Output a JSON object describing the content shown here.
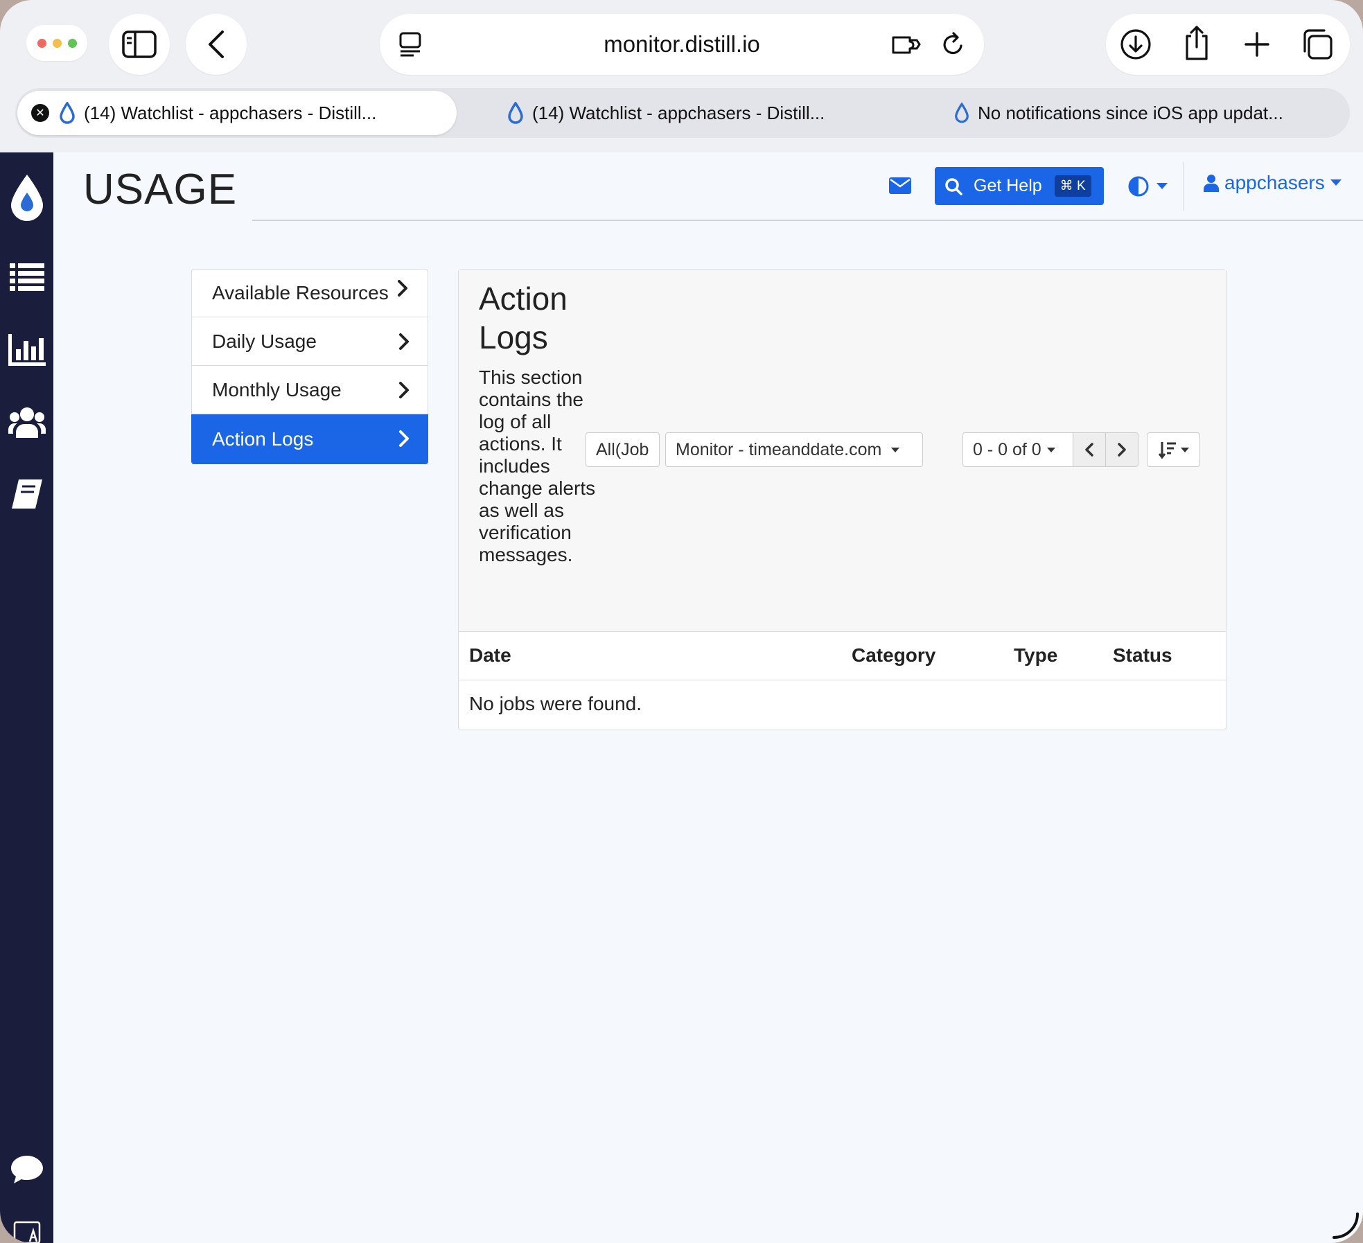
{
  "browser": {
    "url": "monitor.distill.io",
    "tabs": [
      {
        "title": "(14) Watchlist - appchasers - Distill...",
        "active": true
      },
      {
        "title": "(14) Watchlist - appchasers - Distill...",
        "active": false
      },
      {
        "title": "No notifications since iOS app updat...",
        "active": false
      }
    ],
    "tab_close_glyph": "✕"
  },
  "header": {
    "page_title": "USAGE",
    "help_label": "Get Help",
    "help_shortcut": "⌘ K",
    "user_name": "appchasers"
  },
  "menu": {
    "items": [
      {
        "label": "Available Resources",
        "active": false
      },
      {
        "label": "Daily Usage",
        "active": false
      },
      {
        "label": "Monthly Usage",
        "active": false
      },
      {
        "label": "Action Logs",
        "active": true
      }
    ]
  },
  "section": {
    "title": "Action Logs",
    "description": "This section contains the log of all actions. It includes change alerts as well as verification messages.",
    "filter_type": "All(Job",
    "filter_monitor": "Monitor - timeanddate.com",
    "pagination": "0 - 0 of 0"
  },
  "table": {
    "columns": [
      "Date",
      "Category",
      "Type",
      "Status"
    ],
    "empty_message": "No jobs were found."
  },
  "colors": {
    "accent": "#1b66e6",
    "sidebar": "#1b1d3c",
    "drop_logo": "#2a6bd6"
  }
}
